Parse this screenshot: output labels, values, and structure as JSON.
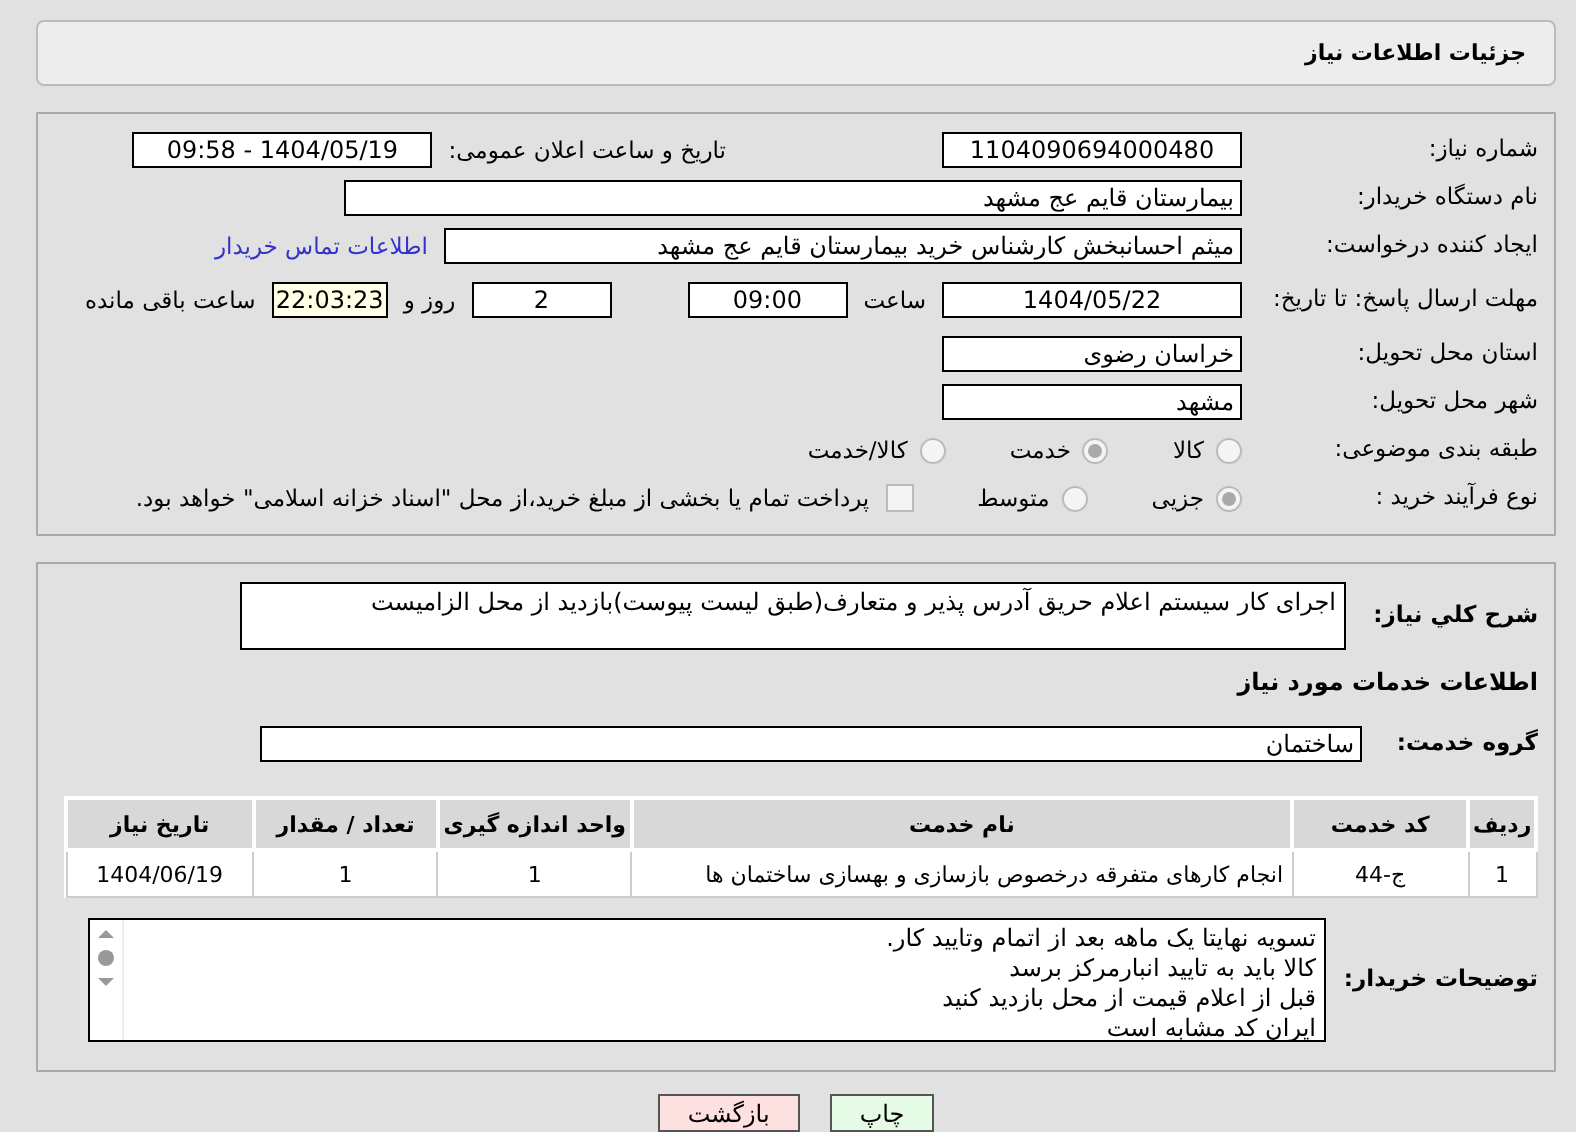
{
  "header": {
    "title": "جزئیات اطلاعات نیاز"
  },
  "details": {
    "need_number": {
      "label": "شماره نیاز:",
      "value": "1104090694000480"
    },
    "announce": {
      "label": "تاریخ و ساعت اعلان عمومی:",
      "value": "1404/05/19 - 09:58"
    },
    "buyer": {
      "label": "نام دستگاه خریدار:",
      "value": "بیمارستان قایم  عج  مشهد"
    },
    "creator": {
      "label": "ایجاد کننده درخواست:",
      "value": "میثم احسانبخش کارشناس خرید بیمارستان قایم  عج  مشهد",
      "link": "اطلاعات تماس خریدار"
    },
    "deadline": {
      "label": "مهلت ارسال پاسخ: تا تاریخ:",
      "date": "1404/05/22",
      "time_label": "ساعت",
      "time": "09:00",
      "days": "2",
      "days_label": "روز و",
      "remaining": "22:03:23",
      "remaining_label": "ساعت باقی مانده"
    },
    "province": {
      "label": "استان محل تحویل:",
      "value": "خراسان رضوی"
    },
    "city": {
      "label": "شهر محل تحویل:",
      "value": "مشهد"
    },
    "category": {
      "label": "طبقه بندی موضوعی:",
      "options": [
        {
          "label": "کالا",
          "selected": false
        },
        {
          "label": "خدمت",
          "selected": true
        },
        {
          "label": "کالا/خدمت",
          "selected": false
        }
      ]
    },
    "purchase_type": {
      "label": "نوع فرآیند خرید :",
      "options": [
        {
          "label": "جزیی",
          "selected": true
        },
        {
          "label": "متوسط",
          "selected": false
        }
      ],
      "payment": {
        "checked": false,
        "text": "پرداخت تمام یا بخشی از مبلغ خرید،از محل \"اسناد خزانه اسلامی\" خواهد بود."
      }
    }
  },
  "services": {
    "description": {
      "label": "شرح کلي نیاز:",
      "value": "اجرای کار سیستم اعلام حریق آدرس پذیر و متعارف(طبق لیست پیوست)بازدید از محل الزامیست"
    },
    "heading": "اطلاعات خدمات مورد نیاز",
    "group": {
      "label": "گروه خدمت:",
      "value": "ساختمان"
    },
    "table": {
      "columns": [
        "ردیف",
        "کد خدمت",
        "نام خدمت",
        "واحد اندازه گیری",
        "تعداد / مقدار",
        "تاریخ نیاز"
      ],
      "rows": [
        [
          "1",
          "ج-44",
          "انجام کارهای متفرقه درخصوص بازسازی و بهسازی ساختمان ها",
          "1",
          "1",
          "1404/06/19"
        ]
      ]
    },
    "notes": {
      "label": "توضیحات خریدار:",
      "lines": [
        "تسویه نهایتا یک ماهه بعد از اتمام وتایید کار.",
        "کالا باید به تایید انبارمرکز برسد",
        "قبل از اعلام قیمت از محل بازدید کنید",
        "ایران کد مشابه است"
      ]
    }
  },
  "buttons": [
    {
      "label": "چاپ",
      "kind": "print"
    },
    {
      "label": "بازگشت",
      "kind": "back"
    }
  ]
}
